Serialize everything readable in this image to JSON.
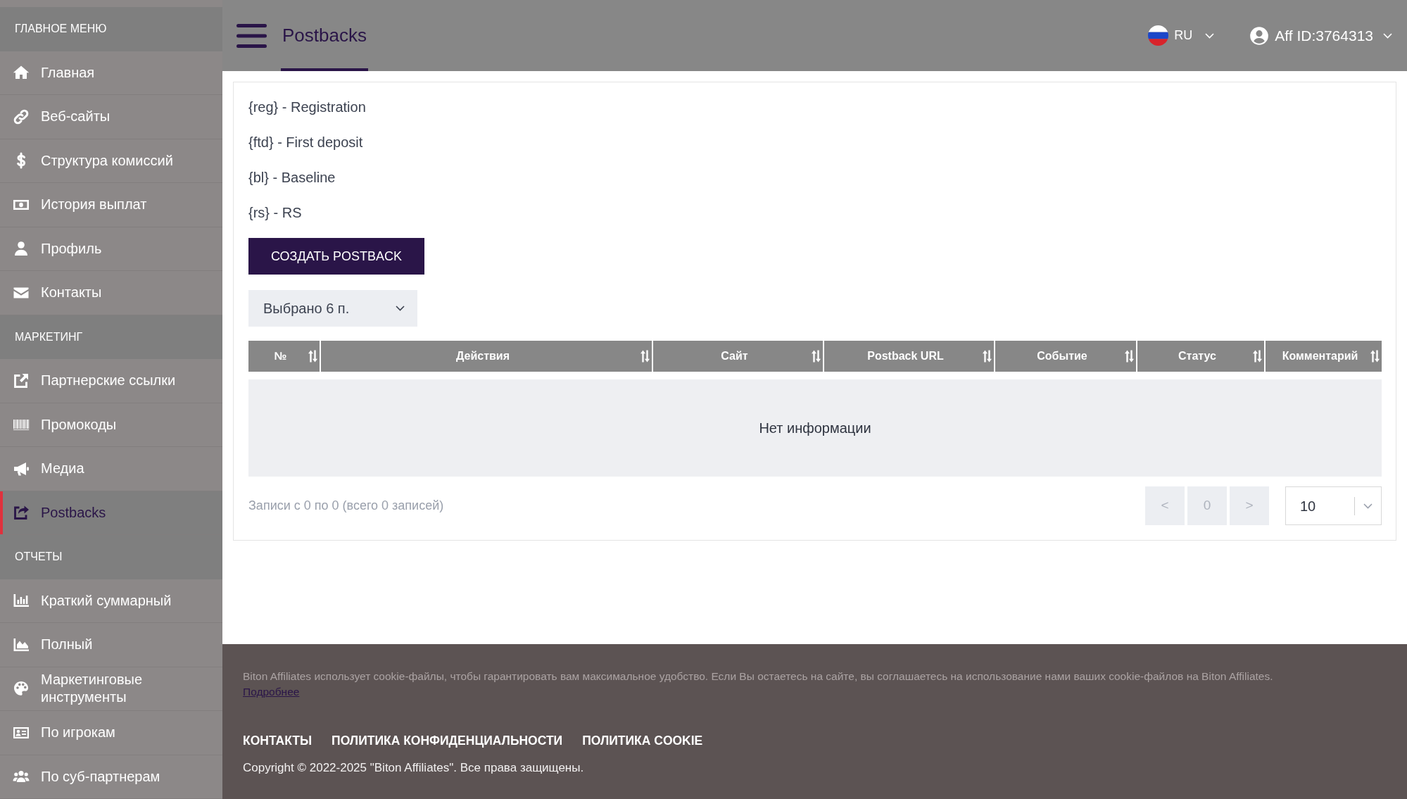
{
  "header": {
    "title": "Postbacks",
    "language": "RU",
    "account": "Aff ID:3764313"
  },
  "sidebar": {
    "sections": [
      {
        "title": "ГЛАВНОЕ МЕНЮ",
        "items": [
          {
            "label": "Главная",
            "selected": false
          },
          {
            "label": "Веб-сайты",
            "selected": false
          },
          {
            "label": "Структура комиссий",
            "selected": false
          },
          {
            "label": "История выплат",
            "selected": false
          },
          {
            "label": "Профиль",
            "selected": false
          },
          {
            "label": "Контакты",
            "selected": false
          }
        ]
      },
      {
        "title": "МАРКЕТИНГ",
        "items": [
          {
            "label": "Партнерские ссылки",
            "selected": false
          },
          {
            "label": "Промокоды",
            "selected": false
          },
          {
            "label": "Медиа",
            "selected": false
          },
          {
            "label": "Postbacks",
            "selected": true
          }
        ]
      },
      {
        "title": "ОТЧЕТЫ",
        "items": [
          {
            "label": "Краткий суммарный",
            "selected": false
          },
          {
            "label": "Полный",
            "selected": false
          },
          {
            "label": "Маркетинговые инструменты",
            "selected": false
          },
          {
            "label": "По игрокам",
            "selected": false
          },
          {
            "label": "По суб-партнерам",
            "selected": false
          }
        ]
      }
    ]
  },
  "legend": [
    "{reg} - Registration",
    "{ftd} - First deposit",
    "{bl} - Baseline",
    "{rs} - RS"
  ],
  "create_button": "СОЗДАТЬ POSTBACK",
  "column_select": "Выбрано 6 п.",
  "table": {
    "columns": [
      "№",
      "Действия",
      "Сайт",
      "Postback URL",
      "Событие",
      "Статус",
      "Комментарий"
    ],
    "empty_message": "Нет информации"
  },
  "pagination": {
    "summary": "Записи с 0 по 0 (всего 0 записей)",
    "prev": {
      "label": "<",
      "disabled": true
    },
    "page": "0",
    "next": {
      "label": ">",
      "disabled": true
    },
    "page_size": "10"
  },
  "footer": {
    "cookie_notice": "Biton Affiliates использует cookie-файлы, чтобы гарантировать вам максимальное удобство. Если Вы остаетесь на сайте, вы соглашаетесь на использование нами ваших cookie-файлов на Biton Affiliates.",
    "more_link": "Подробнее",
    "links": [
      "КОНТАКТЫ",
      "ПОЛИТИКА КОНФИДЕНЦИАЛЬНОСТИ",
      "ПОЛИТИКА COOKIE"
    ],
    "copyright": "Copyright © 2022-2025 \"Biton Affiliates\". Все права защищены."
  }
}
